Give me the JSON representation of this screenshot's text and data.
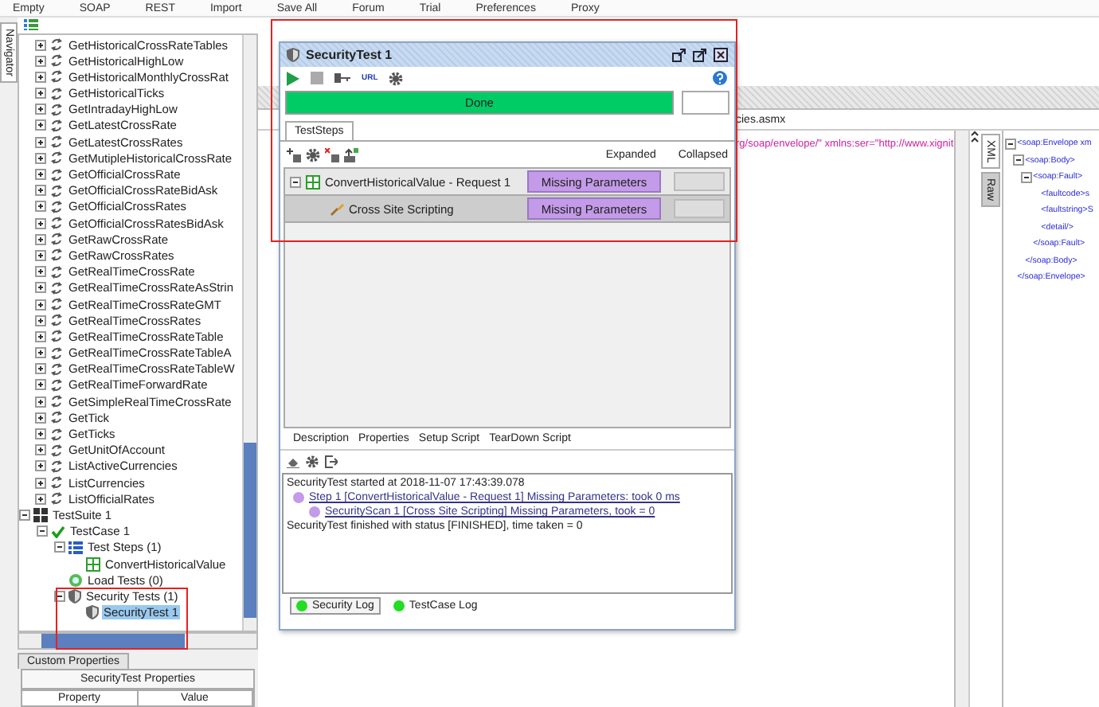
{
  "menu": [
    "Empty",
    "SOAP",
    "REST",
    "Import",
    "Save All",
    "Forum",
    "Trial",
    "Preferences",
    "Proxy"
  ],
  "navigator_tab": "Navigator",
  "tree": [
    {
      "kind": "operation",
      "label": "GetHistoricalCrossRateTables",
      "expanded": false,
      "selected": false
    },
    {
      "kind": "operation",
      "label": "GetHistoricalHighLow",
      "expanded": false,
      "selected": false
    },
    {
      "kind": "operation",
      "label": "GetHistoricalMonthlyCrossRat",
      "expanded": false,
      "selected": false
    },
    {
      "kind": "operation",
      "label": "GetHistoricalTicks",
      "expanded": false,
      "selected": false
    },
    {
      "kind": "operation",
      "label": "GetIntradayHighLow",
      "expanded": false,
      "selected": false
    },
    {
      "kind": "operation",
      "label": "GetLatestCrossRate",
      "expanded": false,
      "selected": false
    },
    {
      "kind": "operation",
      "label": "GetLatestCrossRates",
      "expanded": false,
      "selected": false
    },
    {
      "kind": "operation",
      "label": "GetMutipleHistoricalCrossRate",
      "expanded": false,
      "selected": false
    },
    {
      "kind": "operation",
      "label": "GetOfficialCrossRate",
      "expanded": false,
      "selected": false
    },
    {
      "kind": "operation",
      "label": "GetOfficialCrossRateBidAsk",
      "expanded": false,
      "selected": false
    },
    {
      "kind": "operation",
      "label": "GetOfficialCrossRates",
      "expanded": false,
      "selected": false
    },
    {
      "kind": "operation",
      "label": "GetOfficialCrossRatesBidAsk",
      "expanded": false,
      "selected": false
    },
    {
      "kind": "operation",
      "label": "GetRawCrossRate",
      "expanded": false,
      "selected": false
    },
    {
      "kind": "operation",
      "label": "GetRawCrossRates",
      "expanded": false,
      "selected": false
    },
    {
      "kind": "operation",
      "label": "GetRealTimeCrossRate",
      "expanded": false,
      "selected": false
    },
    {
      "kind": "operation",
      "label": "GetRealTimeCrossRateAsStrin",
      "expanded": false,
      "selected": false
    },
    {
      "kind": "operation",
      "label": "GetRealTimeCrossRateGMT",
      "expanded": false,
      "selected": false
    },
    {
      "kind": "operation",
      "label": "GetRealTimeCrossRates",
      "expanded": false,
      "selected": false
    },
    {
      "kind": "operation",
      "label": "GetRealTimeCrossRateTable",
      "expanded": false,
      "selected": false
    },
    {
      "kind": "operation",
      "label": "GetRealTimeCrossRateTableA",
      "expanded": false,
      "selected": false
    },
    {
      "kind": "operation",
      "label": "GetRealTimeCrossRateTableW",
      "expanded": false,
      "selected": false
    },
    {
      "kind": "operation",
      "label": "GetRealTimeForwardRate",
      "expanded": false,
      "selected": false
    },
    {
      "kind": "operation",
      "label": "GetSimpleRealTimeCrossRate",
      "expanded": false,
      "selected": false
    },
    {
      "kind": "operation",
      "label": "GetTick",
      "expanded": false,
      "selected": false
    },
    {
      "kind": "operation",
      "label": "GetTicks",
      "expanded": false,
      "selected": false
    },
    {
      "kind": "operation",
      "label": "GetUnitOfAccount",
      "expanded": false,
      "selected": false
    },
    {
      "kind": "operation",
      "label": "ListActiveCurrencies",
      "expanded": false,
      "selected": false
    },
    {
      "kind": "operation",
      "label": "ListCurrencies",
      "expanded": false,
      "selected": false
    },
    {
      "kind": "operation",
      "label": "ListOfficialRates",
      "expanded": false,
      "selected": false
    },
    {
      "kind": "suite",
      "label": "TestSuite 1",
      "expanded": true,
      "selected": false,
      "children": [
        {
          "kind": "case",
          "label": "TestCase 1",
          "expanded": true,
          "selected": false,
          "children": [
            {
              "kind": "steps",
              "label": "Test Steps (1)",
              "expanded": true,
              "selected": false,
              "children": [
                {
                  "kind": "step",
                  "label": "ConvertHistoricalValue",
                  "selected": false
                }
              ]
            },
            {
              "kind": "load",
              "label": "Load Tests (0)",
              "selected": false
            },
            {
              "kind": "security",
              "label": "Security Tests (1)",
              "expanded": true,
              "selected": false,
              "children": [
                {
                  "kind": "security_test",
                  "label": "SecurityTest 1",
                  "selected": true
                }
              ]
            }
          ]
        }
      ]
    }
  ],
  "properties_panel": {
    "tab": "Custom Properties",
    "title": "SecurityTest Properties",
    "columns": [
      "Property",
      "Value"
    ]
  },
  "window": {
    "title": "SecurityTest 1",
    "toolbar_label": "URL",
    "progress": {
      "label": "Done",
      "level": 1
    },
    "tabs": [
      {
        "label": "TestSteps",
        "selected": true
      }
    ],
    "columns": [
      "Expanded",
      "Collapsed"
    ],
    "steps": [
      {
        "label": "ConvertHistoricalValue - Request 1",
        "status": "Missing Parameters",
        "expanded": true,
        "children": [
          {
            "label": "Cross Site Scripting",
            "status": "Missing Parameters"
          }
        ]
      }
    ],
    "bottom_tabs": [
      {
        "label": "Description",
        "selected": false
      },
      {
        "label": "Properties",
        "selected": false
      },
      {
        "label": "Setup Script",
        "selected": false
      },
      {
        "label": "TearDown Script",
        "selected": false
      }
    ],
    "log": [
      {
        "kind": "text",
        "text": "SecurityTest started at 2018-11-07 17:43:39.078"
      },
      {
        "kind": "entry",
        "color": "#c39be8",
        "text": "Step 1 [ConvertHistoricalValue - Request 1] Missing Parameters: took 0 ms",
        "children": [
          {
            "kind": "entry",
            "color": "#c39be8",
            "text": "SecurityScan 1 [Cross Site Scripting] Missing Parameters, took = 0"
          }
        ]
      },
      {
        "kind": "text",
        "text": "SecurityTest finished with status [FINISHED], time taken = 0"
      }
    ],
    "log_tabs": [
      {
        "label": "Security Log",
        "selected": true
      },
      {
        "label": "TestCase Log",
        "selected": false
      }
    ]
  },
  "editor": {
    "endpoint": "cies.asmx",
    "request_line": "rg/soap/envelope/\" xmlns:ser=\"http://www.xignit",
    "view_tabs": [
      {
        "label": "XML",
        "selected": true
      },
      {
        "label": "Raw",
        "selected": false
      }
    ],
    "xml": [
      {
        "text": "<soap:Envelope xm",
        "expanded": true,
        "children": [
          {
            "text": "<soap:Body>",
            "expanded": true,
            "children": [
              {
                "text": "<soap:Fault>",
                "expanded": true,
                "children": [
                  {
                    "text": "<faultcode>s"
                  },
                  {
                    "text": "<faultstring>S"
                  },
                  {
                    "text": "<detail/>"
                  }
                ]
              },
              {
                "text": "</soap:Fault>"
              }
            ]
          },
          {
            "text": "</soap:Body>"
          }
        ]
      },
      {
        "text": "</soap:Envelope>"
      }
    ]
  }
}
